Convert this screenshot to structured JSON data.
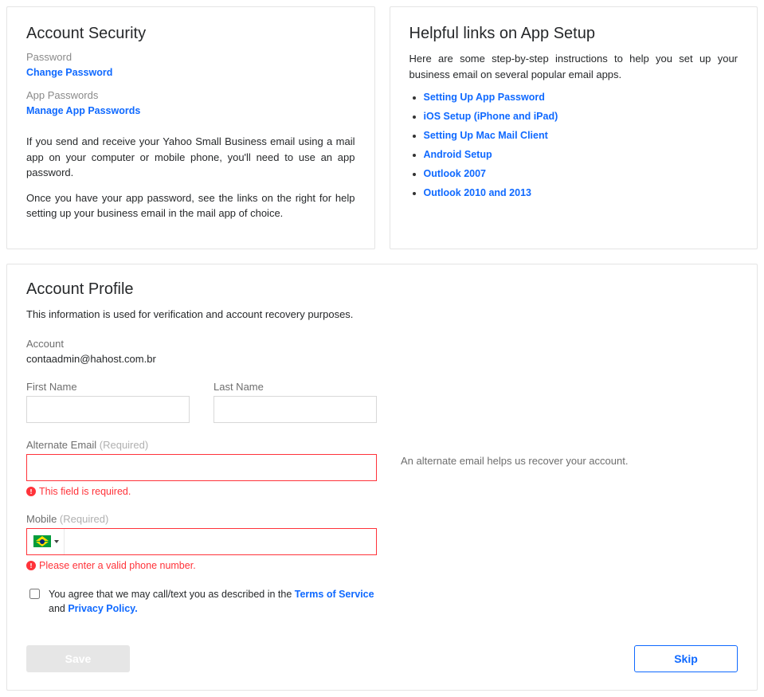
{
  "security": {
    "title": "Account Security",
    "password_label": "Password",
    "change_password": "Change Password",
    "app_passwords_label": "App Passwords",
    "manage_app_passwords": "Manage App Passwords",
    "para1": "If you send and receive your Yahoo Small Business email using a mail app on your computer or mobile phone, you'll need to use an app password.",
    "para2": "Once you have your app password, see the links on the right for help setting up your business email in the mail app of choice."
  },
  "help": {
    "title": "Helpful links on App Setup",
    "intro": "Here are some step-by-step instructions to help you set up your business email on several popular email apps.",
    "links": [
      "Setting Up App Password",
      "iOS Setup (iPhone and iPad)",
      "Setting Up Mac Mail Client",
      "Android Setup",
      "Outlook 2007",
      "Outlook 2010 and 2013"
    ]
  },
  "profile": {
    "title": "Account Profile",
    "description": "This information is used for verification and account recovery purposes.",
    "account_label": "Account",
    "account_value": "contaadmin@hahost.com.br",
    "first_name_label": "First Name",
    "first_name_value": "",
    "last_name_label": "Last Name",
    "last_name_value": "",
    "alt_email_label": "Alternate Email ",
    "required_tag": "(Required)",
    "alt_email_value": "",
    "alt_email_error": "This field is required.",
    "alt_email_hint": "An alternate email helps us recover your account.",
    "mobile_label": "Mobile ",
    "mobile_value": "",
    "mobile_error": "Please enter a valid phone number.",
    "mobile_country": "BR",
    "consent_prefix": " You agree that we may call/text you as described in the ",
    "consent_tos": "Terms of Service",
    "consent_and": " and ",
    "consent_privacy": "Privacy Policy.",
    "save_label": "Save",
    "skip_label": "Skip"
  }
}
